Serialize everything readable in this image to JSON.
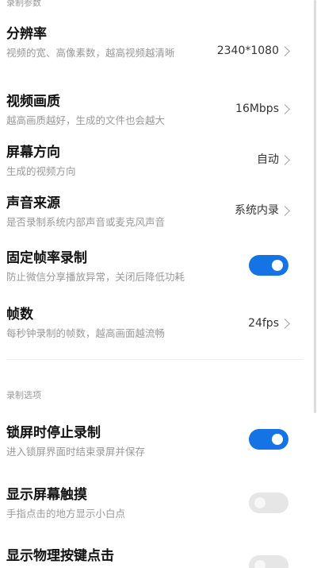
{
  "sections": {
    "recording_params": "录制参数",
    "recording_options": "录制选项"
  },
  "rows": {
    "resolution": {
      "title": "分辨率",
      "desc": "视频的宽、高像素数，越高视频越清晰",
      "value": "2340*1080"
    },
    "quality": {
      "title": "视频画质",
      "desc": "越高画质越好，生成的文件也会越大",
      "value": "16Mbps"
    },
    "orientation": {
      "title": "屏幕方向",
      "desc": "生成的视频方向",
      "value": "自动"
    },
    "audio_source": {
      "title": "声音来源",
      "desc": "是否录制系统内部声音或麦克风声音",
      "value": "系统内录"
    },
    "fixed_frame_rate": {
      "title": "固定帧率录制",
      "desc": "防止微信分享播放异常，关闭后降低功耗",
      "enabled": true
    },
    "frame_rate": {
      "title": "帧数",
      "desc": "每秒钟录制的帧数，越高画面越流畅",
      "value": "24fps"
    },
    "stop_on_lock": {
      "title": "锁屏时停止录制",
      "desc": "进入锁屏界面时结束录屏并保存",
      "enabled": true
    },
    "show_touches": {
      "title": "显示屏幕触摸",
      "desc": "手指点击的地方显示小白点",
      "enabled": false
    },
    "show_key_presses": {
      "title": "显示物理按键点击",
      "enabled": false
    }
  },
  "colors": {
    "accent": "#1673e6",
    "toggle_off": "#e6e6e6"
  }
}
